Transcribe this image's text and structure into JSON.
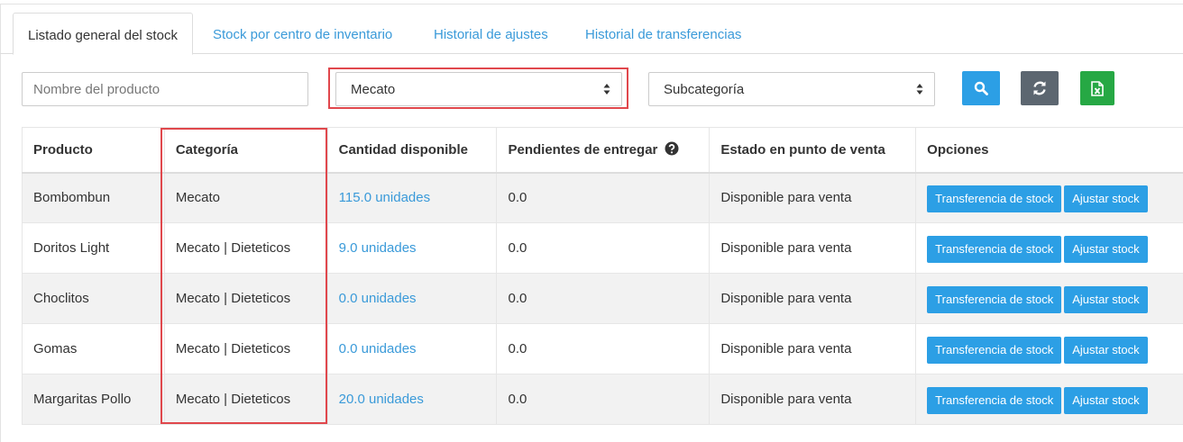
{
  "tabs": [
    {
      "label": "Listado general del stock",
      "active": true
    },
    {
      "label": "Stock por centro de inventario",
      "active": false
    },
    {
      "label": "Historial de ajustes",
      "active": false
    },
    {
      "label": "Historial de transferencias",
      "active": false
    }
  ],
  "filters": {
    "product_placeholder": "Nombre del producto",
    "category_value": "Mecato",
    "subcategory_value": "Subcategoría"
  },
  "buttons": {
    "search_icon": "search-icon",
    "refresh_icon": "refresh-icon",
    "excel_icon": "excel-icon"
  },
  "colors": {
    "link": "#3a9ad9",
    "highlight": "#e0474c",
    "search_btn": "#2c9fe5",
    "refresh_btn": "#5c6670",
    "excel_btn": "#26a844"
  },
  "table": {
    "headers": {
      "product": "Producto",
      "category": "Categoría",
      "qty": "Cantidad disponible",
      "pending": "Pendientes de entregar",
      "status": "Estado en punto de venta",
      "options": "Opciones"
    },
    "rows": [
      {
        "product": "Bombombun",
        "category": "Mecato",
        "qty": "115.0 unidades",
        "pending": "0.0",
        "status": "Disponible para venta",
        "transfer": "Transferencia de stock",
        "adjust": "Ajustar stock"
      },
      {
        "product": "Doritos Light",
        "category": "Mecato | Dieteticos",
        "qty": "9.0 unidades",
        "pending": "0.0",
        "status": "Disponible para venta",
        "transfer": "Transferencia de stock",
        "adjust": "Ajustar stock"
      },
      {
        "product": "Choclitos",
        "category": "Mecato | Dieteticos",
        "qty": "0.0 unidades",
        "pending": "0.0",
        "status": "Disponible para venta",
        "transfer": "Transferencia de stock",
        "adjust": "Ajustar stock"
      },
      {
        "product": "Gomas",
        "category": "Mecato | Dieteticos",
        "qty": "0.0 unidades",
        "pending": "0.0",
        "status": "Disponible para venta",
        "transfer": "Transferencia de stock",
        "adjust": "Ajustar stock"
      },
      {
        "product": "Margaritas Pollo",
        "category": "Mecato | Dieteticos",
        "qty": "20.0 unidades",
        "pending": "0.0",
        "status": "Disponible para venta",
        "transfer": "Transferencia de stock",
        "adjust": "Ajustar stock"
      }
    ]
  }
}
